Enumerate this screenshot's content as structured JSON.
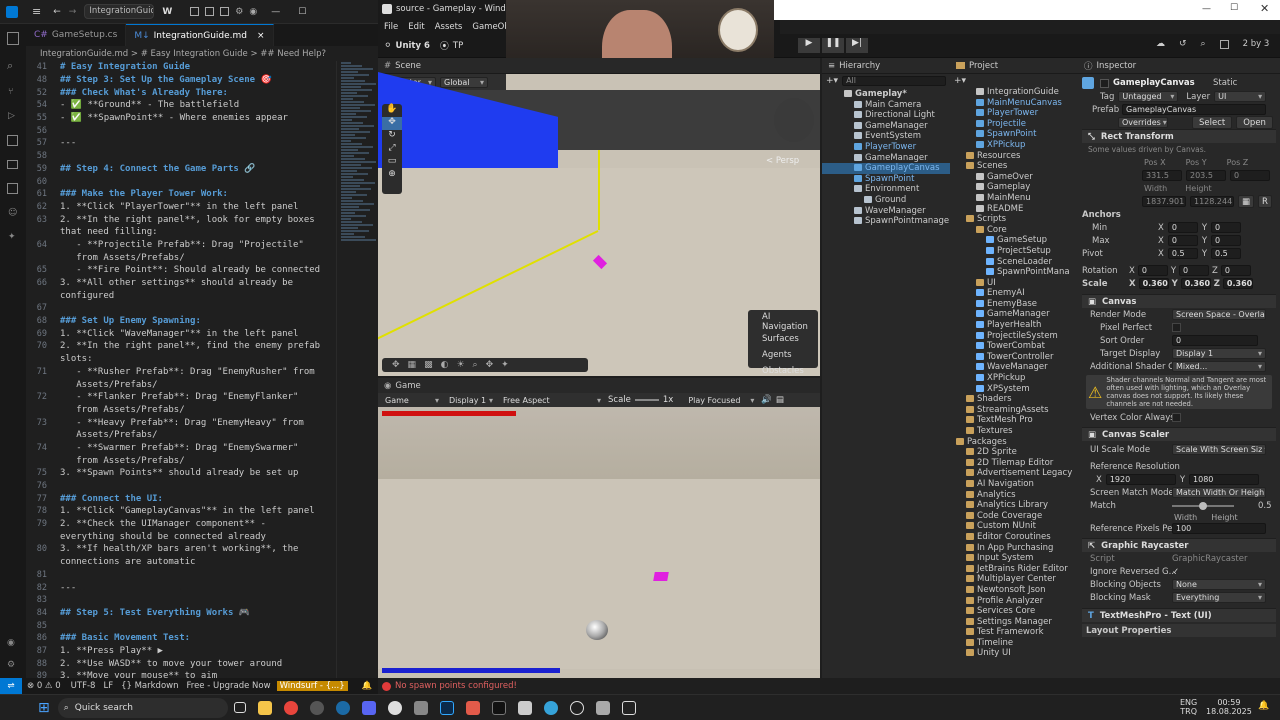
{
  "vscode": {
    "title_tab": "IntegrationGuide...",
    "tabs": [
      {
        "label": "GameSetup.cs",
        "active": false
      },
      {
        "label": "IntegrationGuide.md",
        "active": true
      }
    ],
    "breadcrumb": "IntegrationGuide.md > # Easy Integration Guide > ## Need Help?",
    "lines": [
      {
        "n": "41",
        "t": "# Easy Integration Guide",
        "k": "h"
      },
      {
        "n": "48",
        "t": "## Step 3: Set Up the Gameplay Scene 🎯",
        "k": "h"
      },
      {
        "n": "52",
        "t": "### Check What's Already There:",
        "k": "h"
      },
      {
        "n": "54",
        "t": "- ✅ **Ground** - The battlefield",
        "k": "c"
      },
      {
        "n": "55",
        "t": "- ✅ **SpawnPoint** - Where enemies appear",
        "k": "c"
      },
      {
        "n": "56",
        "t": "",
        "k": ""
      },
      {
        "n": "57",
        "t": "---",
        "k": ""
      },
      {
        "n": "58",
        "t": "",
        "k": ""
      },
      {
        "n": "59",
        "t": "## Step 4: Connect the Game Parts 🔗",
        "k": "h"
      },
      {
        "n": "60",
        "t": "",
        "k": ""
      },
      {
        "n": "61",
        "t": "### Make the Player Tower Work:",
        "k": "h"
      },
      {
        "n": "62",
        "t": "1. **Click \"PlayerTower\"** in the left panel",
        "k": ""
      },
      {
        "n": "63",
        "t": "2. **In the right panel**, look for empty boxes",
        "k": ""
      },
      {
        "n": "",
        "t": "that need filling:",
        "k": ""
      },
      {
        "n": "64",
        "t": "   - **Projectile Prefab**: Drag \"Projectile\"",
        "k": ""
      },
      {
        "n": "",
        "t": "   from Assets/Prefabs/",
        "k": ""
      },
      {
        "n": "65",
        "t": "   - **Fire Point**: Should already be connected",
        "k": ""
      },
      {
        "n": "66",
        "t": "3. **All other settings** should already be",
        "k": ""
      },
      {
        "n": "",
        "t": "configured",
        "k": ""
      },
      {
        "n": "67",
        "t": "",
        "k": ""
      },
      {
        "n": "68",
        "t": "### Set Up Enemy Spawning:",
        "k": "h"
      },
      {
        "n": "69",
        "t": "1. **Click \"WaveManager\"** in the left panel",
        "k": ""
      },
      {
        "n": "70",
        "t": "2. **In the right panel**, find the enemy prefab",
        "k": ""
      },
      {
        "n": "",
        "t": "slots:",
        "k": ""
      },
      {
        "n": "71",
        "t": "   - **Rusher Prefab**: Drag \"EnemyRusher\" from",
        "k": ""
      },
      {
        "n": "",
        "t": "   Assets/Prefabs/",
        "k": ""
      },
      {
        "n": "72",
        "t": "   - **Flanker Prefab**: Drag \"EnemyFlanker\"",
        "k": ""
      },
      {
        "n": "",
        "t": "   from Assets/Prefabs/",
        "k": ""
      },
      {
        "n": "73",
        "t": "   - **Heavy Prefab**: Drag \"EnemyHeavy\" from",
        "k": ""
      },
      {
        "n": "",
        "t": "   Assets/Prefabs/",
        "k": ""
      },
      {
        "n": "74",
        "t": "   - **Swarmer Prefab**: Drag \"EnemySwarmer\"",
        "k": ""
      },
      {
        "n": "",
        "t": "   from Assets/Prefabs/",
        "k": ""
      },
      {
        "n": "75",
        "t": "3. **Spawn Points** should already be set up",
        "k": ""
      },
      {
        "n": "76",
        "t": "",
        "k": ""
      },
      {
        "n": "77",
        "t": "### Connect the UI:",
        "k": "h"
      },
      {
        "n": "78",
        "t": "1. **Click \"GameplayCanvas\"** in the left panel",
        "k": ""
      },
      {
        "n": "79",
        "t": "2. **Check the UIManager component** -",
        "k": ""
      },
      {
        "n": "",
        "t": "everything should be connected already",
        "k": ""
      },
      {
        "n": "80",
        "t": "3. **If health/XP bars aren't working**, the",
        "k": ""
      },
      {
        "n": "",
        "t": "connections are automatic",
        "k": ""
      },
      {
        "n": "81",
        "t": "",
        "k": ""
      },
      {
        "n": "82",
        "t": "---",
        "k": ""
      },
      {
        "n": "83",
        "t": "",
        "k": ""
      },
      {
        "n": "84",
        "t": "## Step 5: Test Everything Works 🎮",
        "k": "h"
      },
      {
        "n": "85",
        "t": "",
        "k": ""
      },
      {
        "n": "86",
        "t": "### Basic Movement Test:",
        "k": "h"
      },
      {
        "n": "87",
        "t": "1. **Press Play** ▶",
        "k": ""
      },
      {
        "n": "88",
        "t": "2. **Use WASD** to move your tower around",
        "k": ""
      },
      {
        "n": "89",
        "t": "3. **Move your mouse** to aim",
        "k": ""
      }
    ],
    "status": {
      "branch": "⊗ 0 ⚠ 0",
      "encoding": "UTF-8",
      "eol": "LF",
      "lang": "{} Markdown",
      "upgrade": "Free - Upgrade Now",
      "windsurf": "Windsurf - {...}"
    }
  },
  "unity": {
    "window_title": "source - Gameplay - Windows,",
    "menu": [
      "File",
      "Edit",
      "Assets",
      "GameObject"
    ],
    "version": "Unity 6",
    "tp": "TP",
    "layout": "2 by 3",
    "scene_tab": "Scene",
    "scene_tools": {
      "pivot": "Center",
      "space": "Global"
    },
    "persp": "< Persp",
    "ai_nav": {
      "title": "AI Navigation",
      "items": [
        "Surfaces",
        "Agents",
        "Obstacles"
      ]
    },
    "game_tab": "Game",
    "game_bar": {
      "mode": "Game",
      "display": "Display 1",
      "aspect": "Free Aspect",
      "scale_label": "Scale",
      "scale": "1x",
      "focus": "Play Focused"
    },
    "console_msg": "No spawn points configured!",
    "hierarchy": {
      "tab": "Hierarchy",
      "search": "All",
      "items": [
        {
          "label": "Gameplay*",
          "depth": 0,
          "type": "scene"
        },
        {
          "label": "Main Camera",
          "depth": 1,
          "type": "cube"
        },
        {
          "label": "Directional Light",
          "depth": 1,
          "type": "cube"
        },
        {
          "label": "GameManager",
          "depth": 1,
          "type": "cube"
        },
        {
          "label": "EventSystem",
          "depth": 1,
          "type": "cube"
        },
        {
          "label": "PlayerTower",
          "depth": 1,
          "type": "prefab"
        },
        {
          "label": "GameManager",
          "depth": 1,
          "type": "cube"
        },
        {
          "label": "GameplayCanvas",
          "depth": 1,
          "type": "prefab",
          "selected": true
        },
        {
          "label": "SpawnPoint",
          "depth": 1,
          "type": "prefab"
        },
        {
          "label": "Environment",
          "depth": 1,
          "type": "cube"
        },
        {
          "label": "Ground",
          "depth": 2,
          "type": "cube"
        },
        {
          "label": "WaveManager",
          "depth": 1,
          "type": "cube"
        },
        {
          "label": "SpawnPointmanage",
          "depth": 1,
          "type": "cube"
        }
      ]
    },
    "project": {
      "tab": "Project",
      "items": [
        {
          "label": "IntegrationGuide",
          "depth": 2,
          "type": "file"
        },
        {
          "label": "MainMenuCanvas",
          "depth": 2,
          "type": "prefab"
        },
        {
          "label": "PlayerTower",
          "depth": 2,
          "type": "prefab"
        },
        {
          "label": "Projectile",
          "depth": 2,
          "type": "prefab"
        },
        {
          "label": "SpawnPoint",
          "depth": 2,
          "type": "prefab"
        },
        {
          "label": "XPPickup",
          "depth": 2,
          "type": "prefab"
        },
        {
          "label": "Resources",
          "depth": 1,
          "type": "folder"
        },
        {
          "label": "Scenes",
          "depth": 1,
          "type": "folder"
        },
        {
          "label": "GameOver",
          "depth": 2,
          "type": "file"
        },
        {
          "label": "Gameplay",
          "depth": 2,
          "type": "file"
        },
        {
          "label": "MainMenu",
          "depth": 2,
          "type": "file"
        },
        {
          "label": "README",
          "depth": 2,
          "type": "file"
        },
        {
          "label": "Scripts",
          "depth": 1,
          "type": "folder"
        },
        {
          "label": "Core",
          "depth": 2,
          "type": "folder"
        },
        {
          "label": "GameSetup",
          "depth": 3,
          "type": "script"
        },
        {
          "label": "ProjectSetup",
          "depth": 3,
          "type": "script"
        },
        {
          "label": "SceneLoader",
          "depth": 3,
          "type": "script"
        },
        {
          "label": "SpawnPointMana",
          "depth": 3,
          "type": "script"
        },
        {
          "label": "UI",
          "depth": 2,
          "type": "folder"
        },
        {
          "label": "EnemyAI",
          "depth": 2,
          "type": "script"
        },
        {
          "label": "EnemyBase",
          "depth": 2,
          "type": "script"
        },
        {
          "label": "GameManager",
          "depth": 2,
          "type": "script"
        },
        {
          "label": "PlayerHealth",
          "depth": 2,
          "type": "script"
        },
        {
          "label": "ProjectileSystem",
          "depth": 2,
          "type": "script"
        },
        {
          "label": "TowerCombat",
          "depth": 2,
          "type": "script"
        },
        {
          "label": "TowerController",
          "depth": 2,
          "type": "script"
        },
        {
          "label": "WaveManager",
          "depth": 2,
          "type": "script"
        },
        {
          "label": "XPPickup",
          "depth": 2,
          "type": "script"
        },
        {
          "label": "XPSystem",
          "depth": 2,
          "type": "script"
        },
        {
          "label": "Shaders",
          "depth": 1,
          "type": "folder"
        },
        {
          "label": "StreamingAssets",
          "depth": 1,
          "type": "folder"
        },
        {
          "label": "TextMesh Pro",
          "depth": 1,
          "type": "folder"
        },
        {
          "label": "Textures",
          "depth": 1,
          "type": "folder"
        },
        {
          "label": "Packages",
          "depth": 0,
          "type": "folder"
        },
        {
          "label": "2D Sprite",
          "depth": 1,
          "type": "folder"
        },
        {
          "label": "2D Tilemap Editor",
          "depth": 1,
          "type": "folder"
        },
        {
          "label": "Advertisement Legacy",
          "depth": 1,
          "type": "folder"
        },
        {
          "label": "AI Navigation",
          "depth": 1,
          "type": "folder"
        },
        {
          "label": "Analytics",
          "depth": 1,
          "type": "folder"
        },
        {
          "label": "Analytics Library",
          "depth": 1,
          "type": "folder"
        },
        {
          "label": "Code Coverage",
          "depth": 1,
          "type": "folder"
        },
        {
          "label": "Custom NUnit",
          "depth": 1,
          "type": "folder"
        },
        {
          "label": "Editor Coroutines",
          "depth": 1,
          "type": "folder"
        },
        {
          "label": "In App Purchasing",
          "depth": 1,
          "type": "folder"
        },
        {
          "label": "Input System",
          "depth": 1,
          "type": "folder"
        },
        {
          "label": "JetBrains Rider Editor",
          "depth": 1,
          "type": "folder"
        },
        {
          "label": "Multiplayer Center",
          "depth": 1,
          "type": "folder"
        },
        {
          "label": "Newtonsoft Json",
          "depth": 1,
          "type": "folder"
        },
        {
          "label": "Profile Analyzer",
          "depth": 1,
          "type": "folder"
        },
        {
          "label": "Services Core",
          "depth": 1,
          "type": "folder"
        },
        {
          "label": "Settings Manager",
          "depth": 1,
          "type": "folder"
        },
        {
          "label": "Test Framework",
          "depth": 1,
          "type": "folder"
        },
        {
          "label": "Timeline",
          "depth": 1,
          "type": "folder"
        },
        {
          "label": "Unity UI",
          "depth": 1,
          "type": "folder"
        }
      ]
    },
    "inspector": {
      "tab": "Inspector",
      "name": "GameplayCanvas",
      "static": "Static",
      "tag_label": "Tag",
      "tag": "Untagged",
      "layer_label": "Layer",
      "layer": "UI",
      "prefab_label": "Prefab",
      "prefab": "GameplayCanvas",
      "overrides": "Overrides",
      "select": "Select",
      "open": "Open",
      "rect_title": "Rect Transform",
      "rect_note": "Some values driven by Canvas.",
      "pos_headers": [
        "Pos X",
        "Pos Y",
        "Pos Z"
      ],
      "pos_vals": [
        "331.5",
        "203.5",
        "0"
      ],
      "size_headers": [
        "Width",
        "Height"
      ],
      "size_vals": [
        "1837.901",
        "1128.244"
      ],
      "anchors": "Anchors",
      "min": "Min",
      "min_x": "0",
      "min_y": "0",
      "max": "Max",
      "max_x": "0",
      "max_y": "0",
      "pivot": "Pivot",
      "pivot_x": "0.5",
      "pivot_y": "0.5",
      "rotation": "Rotation",
      "rot": [
        "0",
        "0",
        "0"
      ],
      "scale": "Scale",
      "scale_vals": [
        "0.360",
        "0.360",
        "0.360"
      ],
      "canvas_title": "Canvas",
      "render_mode_label": "Render Mode",
      "render_mode": "Screen Space - Overla",
      "pixel_perfect": "Pixel Perfect",
      "sort_order_label": "Sort Order",
      "sort_order": "0",
      "target_display_label": "Target Display",
      "target_display": "Display 1",
      "shader_channels_label": "Additional Shader Ch",
      "shader_channels": "Mixed...",
      "warning": "Shader channels Normal and Tangent are most often used with lighting, which an Overlay canvas does not support. Its likely these channels are not needed.",
      "vertex_color": "Vertex Color Always",
      "scaler_title": "Canvas Scaler",
      "ui_scale_label": "UI Scale Mode",
      "ui_scale": "Scale With Screen Siz",
      "ref_res": "Reference Resolution",
      "ref_x": "1920",
      "ref_y": "1080",
      "match_mode_label": "Screen Match Mode",
      "match_mode": "Match Width Or Heigh",
      "match_label": "Match",
      "match_val": "0.5",
      "match_fraction": 0.5,
      "width_lbl": "Width",
      "height_lbl": "Height",
      "ref_ppu_label": "Reference Pixels Per",
      "ref_ppu": "100",
      "raycaster_title": "Graphic Raycaster",
      "script_label": "Script",
      "script": "GraphicRaycaster",
      "ignore_label": "Ignore Reversed G...",
      "blocking_obj_label": "Blocking Objects",
      "blocking_obj": "None",
      "blocking_mask_label": "Blocking Mask",
      "blocking_mask": "Everything",
      "tmp_title": "TextMeshPro - Text (UI)",
      "layout_props": "Layout Properties"
    }
  },
  "taskbar": {
    "search": "Quick search",
    "lang1": "ENG",
    "lang2": "TRQ",
    "time": "00:59",
    "date": "18.08.2025"
  }
}
